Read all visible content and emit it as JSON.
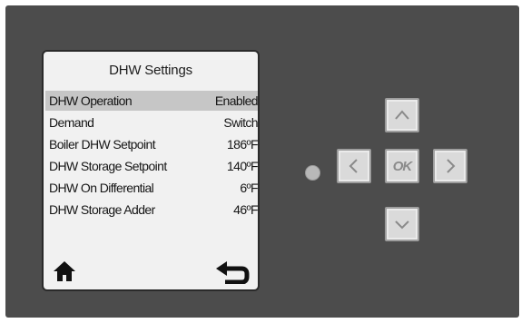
{
  "screen": {
    "title": "DHW Settings",
    "rows": [
      {
        "label": "DHW Operation",
        "value": "Enabled",
        "selected": true
      },
      {
        "label": "Demand",
        "value": "Switch",
        "selected": false
      },
      {
        "label": "Boiler DHW Setpoint",
        "value": "186ºF",
        "selected": false
      },
      {
        "label": "DHW Storage Setpoint",
        "value": "140ºF",
        "selected": false
      },
      {
        "label": "DHW On Differential",
        "value": "6ºF",
        "selected": false
      },
      {
        "label": "DHW Storage Adder",
        "value": "46ºF",
        "selected": false
      }
    ],
    "footer": {
      "left_icon": "home-icon",
      "right_icon": "return-arrow-icon"
    }
  },
  "keypad": {
    "ok_label": "OK",
    "buttons": [
      "up",
      "left",
      "ok",
      "right",
      "down"
    ]
  },
  "status_led": {
    "color": "#b8b8b8"
  }
}
